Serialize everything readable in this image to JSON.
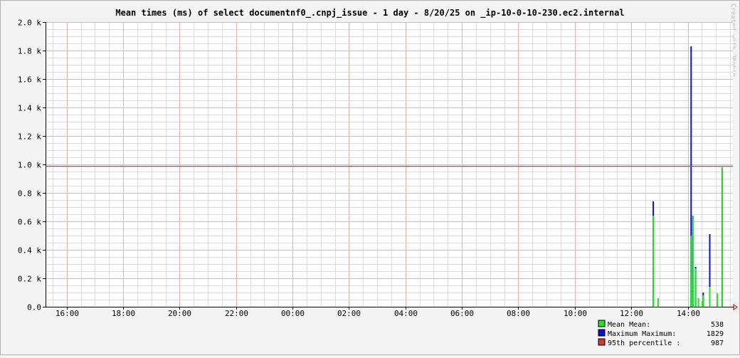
{
  "title": "Mean times (ms) of select documentnf0_.cnpj_issue - 1 day - 8/20/25 on _ip-10-0-10-230.ec2.internal",
  "watermark": "Created with JRobin",
  "colors": {
    "background": "#f3f3f3",
    "canvas": "#ffffff",
    "minor_grid": "#dcdcdc",
    "major_grid": "#e0b4ad",
    "axis": "#000000",
    "mean": "#22e022",
    "maximum": "#1010c8",
    "percentile": "#cc3a3a"
  },
  "chart_data": {
    "type": "bar",
    "title": "Mean times (ms) of select documentnf0_.cnpj_issue - 1 day - 8/20/25 on _ip-10-0-10-230.ec2.internal",
    "xlabel": "",
    "ylabel": "",
    "x_range_hours": [
      15.25,
      39.6
    ],
    "ylim": [
      0,
      2000
    ],
    "x_ticks": [
      "16:00",
      "18:00",
      "20:00",
      "22:00",
      "00:00",
      "02:00",
      "04:00",
      "06:00",
      "08:00",
      "10:00",
      "12:00",
      "14:00"
    ],
    "y_ticks": [
      "0.0",
      "0.2 k",
      "0.4 k",
      "0.6 k",
      "0.8 k",
      "1.0 k",
      "1.2 k",
      "1.4 k",
      "1.6 k",
      "1.8 k",
      "2.0 k"
    ],
    "grid": true,
    "legend_position": "bottom-right",
    "series": [
      {
        "name": "Mean",
        "points": [
          {
            "t": 36.78,
            "v": 640
          },
          {
            "t": 36.95,
            "v": 60
          },
          {
            "t": 38.12,
            "v": 500
          },
          {
            "t": 38.15,
            "v": 180
          },
          {
            "t": 38.18,
            "v": 640
          },
          {
            "t": 38.28,
            "v": 270
          },
          {
            "t": 38.38,
            "v": 60
          },
          {
            "t": 38.52,
            "v": 40
          },
          {
            "t": 38.55,
            "v": 80
          },
          {
            "t": 38.78,
            "v": 140
          },
          {
            "t": 39.05,
            "v": 95
          },
          {
            "t": 39.22,
            "v": 980
          }
        ]
      },
      {
        "name": "Maximum",
        "points": [
          {
            "t": 36.78,
            "v": 740
          },
          {
            "t": 38.12,
            "v": 1829
          },
          {
            "t": 38.18,
            "v": 640
          },
          {
            "t": 38.28,
            "v": 280
          },
          {
            "t": 38.55,
            "v": 100
          },
          {
            "t": 38.78,
            "v": 510
          },
          {
            "t": 39.22,
            "v": 980
          }
        ]
      },
      {
        "name": "95th percentile",
        "constant": 987
      }
    ]
  },
  "legend": [
    {
      "label": "Mean  Mean:",
      "value": "538",
      "color": "#22e022"
    },
    {
      "label": "Maximum  Maximum:",
      "value": "1829",
      "color": "#1010c8"
    },
    {
      "label": "95th percentile  :",
      "value": "987",
      "color": "#cc3a3a"
    }
  ]
}
